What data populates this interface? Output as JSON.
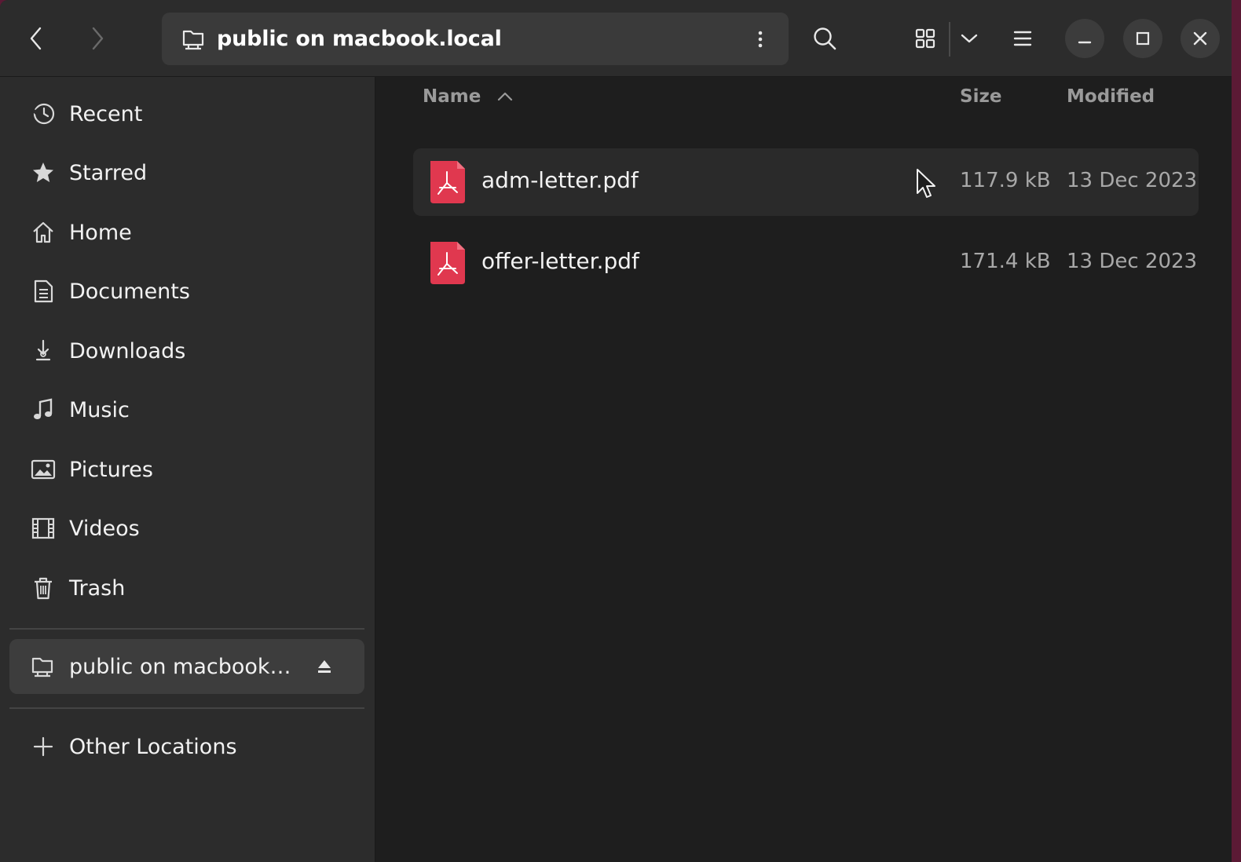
{
  "header": {
    "location": "public on macbook.local",
    "icons": {
      "back": "chevron-left-icon",
      "forward": "chevron-right-icon",
      "location": "network-folder-icon",
      "more": "vertical-ellipsis-icon",
      "search": "search-icon",
      "view": "grid-view-icon",
      "view_options": "chevron-down-icon",
      "menu": "hamburger-menu-icon",
      "minimize": "minimize-icon",
      "maximize": "maximize-icon",
      "close": "close-icon"
    }
  },
  "sidebar": {
    "items": [
      {
        "label": "Recent",
        "icon": "clock-icon"
      },
      {
        "label": "Starred",
        "icon": "star-icon"
      },
      {
        "label": "Home",
        "icon": "home-icon"
      },
      {
        "label": "Documents",
        "icon": "document-icon"
      },
      {
        "label": "Downloads",
        "icon": "download-icon"
      },
      {
        "label": "Music",
        "icon": "music-icon"
      },
      {
        "label": "Pictures",
        "icon": "picture-icon"
      },
      {
        "label": "Videos",
        "icon": "film-icon"
      },
      {
        "label": "Trash",
        "icon": "trash-icon"
      }
    ],
    "mount": {
      "label": "public on macbook…",
      "icon": "network-folder-icon",
      "eject_icon": "eject-icon"
    },
    "other": {
      "label": "Other Locations",
      "icon": "plus-icon"
    }
  },
  "columns": {
    "name": "Name",
    "size": "Size",
    "modified": "Modified",
    "sort_icon": "chevron-up-icon"
  },
  "files": [
    {
      "name": "adm-letter.pdf",
      "size": "117.9 kB",
      "modified": "13 Dec 2023",
      "icon": "pdf-icon"
    },
    {
      "name": "offer-letter.pdf",
      "size": "171.4 kB",
      "modified": "13 Dec 2023",
      "icon": "pdf-icon"
    }
  ],
  "colors": {
    "background": "#1e1e1e",
    "sidebar": "#2c2c2c",
    "pdf_accent": "#e0384f",
    "desktop_accent": "#5b1a35"
  }
}
